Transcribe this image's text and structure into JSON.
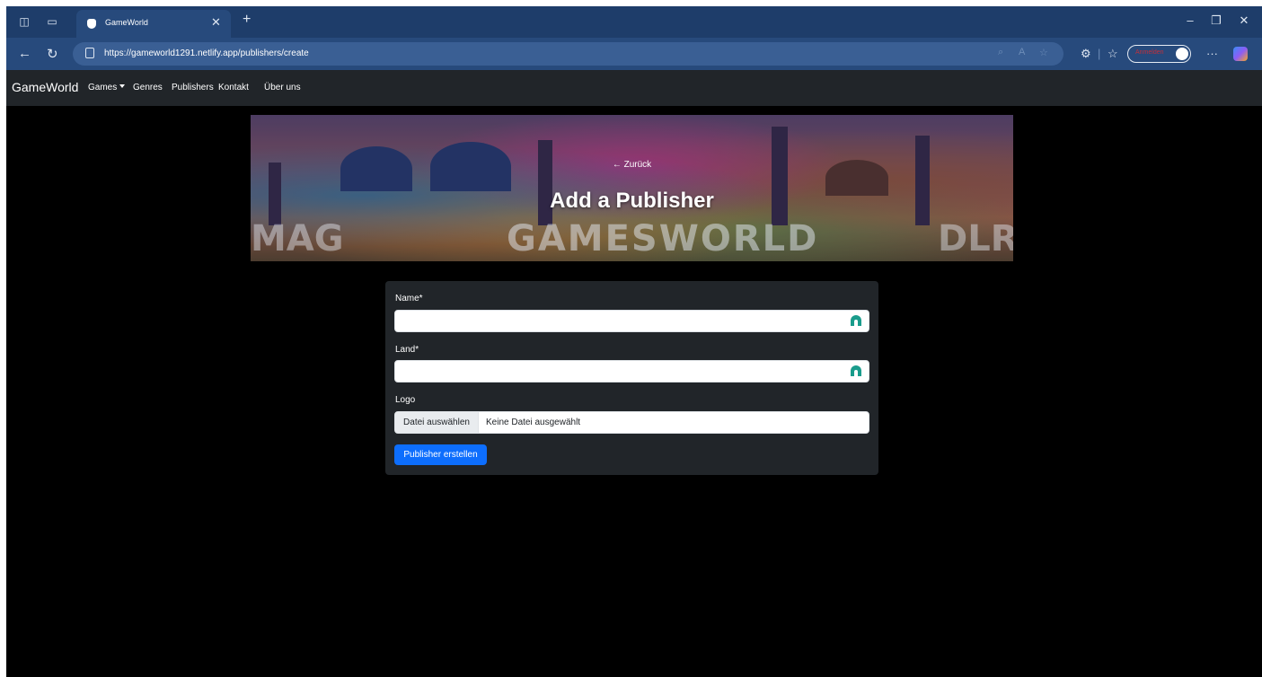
{
  "browser": {
    "tab_title": "GameWorld",
    "url": "https://gameworld1291.netlify.app/publishers/create",
    "profile_label": "Anmelden"
  },
  "navbar": {
    "brand": "GameWorld",
    "links": [
      "Games",
      "Genres",
      "Publishers",
      "Kontakt",
      "Über uns"
    ]
  },
  "hero": {
    "back_link": "← Zurück",
    "title": "Add a Publisher",
    "watermark": "GAMESWORLD",
    "watermark_left": "MAG",
    "watermark_right": "DLRO"
  },
  "form": {
    "name_label": "Name*",
    "name_value": "",
    "country_label": "Land*",
    "country_value": "",
    "logo_label": "Logo",
    "file_button": "Datei auswählen",
    "file_status": "Keine Datei ausgewählt",
    "submit": "Publisher erstellen"
  },
  "colors": {
    "page_background": "#000000",
    "navbar": "#212529",
    "card": "#212529",
    "primary_button": "#0d6efd",
    "browser_chrome": "#274a7c",
    "password_manager_icon": "#1a9c8c"
  },
  "icons": [
    "sidebar-icon",
    "tab-actions-icon",
    "back-arrow-icon",
    "refresh-icon",
    "lock-icon",
    "zoom-icon",
    "read-aloud-icon",
    "favorite-icon",
    "extensions-icon",
    "favorites-list-icon",
    "more-icon",
    "copilot-icon",
    "password-manager-icon"
  ]
}
